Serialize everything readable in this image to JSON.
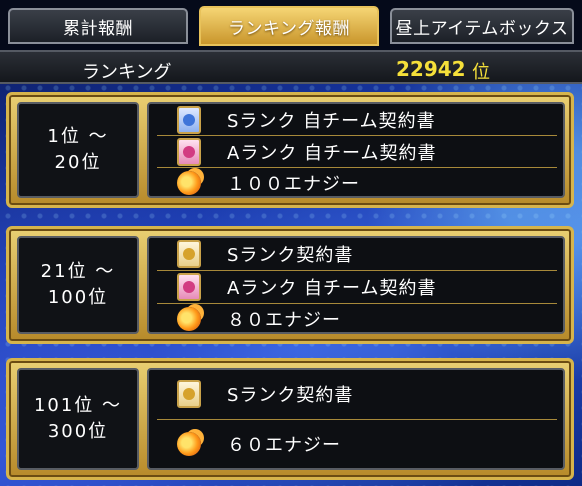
{
  "tabs": [
    {
      "label": "累計報酬",
      "active": false
    },
    {
      "label": "ランキング報酬",
      "active": true
    },
    {
      "label": "昼上アイテムボックス",
      "active": false
    }
  ],
  "ranking": {
    "label": "ランキング",
    "value": "22942",
    "unit": "位"
  },
  "tiers": [
    {
      "rank_line1": "1位 ～",
      "rank_line2": "20位",
      "rewards": [
        {
          "icon": "s-rank-team-contract-icon",
          "text": "Sランク 自チーム契約書"
        },
        {
          "icon": "a-rank-team-contract-icon",
          "text": "Aランク 自チーム契約書"
        },
        {
          "icon": "energy-icon",
          "text": "１００エナジー"
        }
      ]
    },
    {
      "rank_line1": "21位 ～",
      "rank_line2": "100位",
      "rewards": [
        {
          "icon": "s-rank-contract-icon",
          "text": "Sランク契約書"
        },
        {
          "icon": "a-rank-team-contract-icon",
          "text": "Aランク 自チーム契約書"
        },
        {
          "icon": "energy-icon",
          "text": "８０エナジー"
        }
      ]
    },
    {
      "rank_line1": "101位 ～",
      "rank_line2": "300位",
      "rewards": [
        {
          "icon": "s-rank-contract-icon",
          "text": "Sランク契約書"
        },
        {
          "icon": "energy-icon",
          "text": "６０エナジー"
        }
      ]
    }
  ],
  "colors": {
    "accent_gold": "#d6b44c",
    "rank_value": "#f5e03a"
  }
}
